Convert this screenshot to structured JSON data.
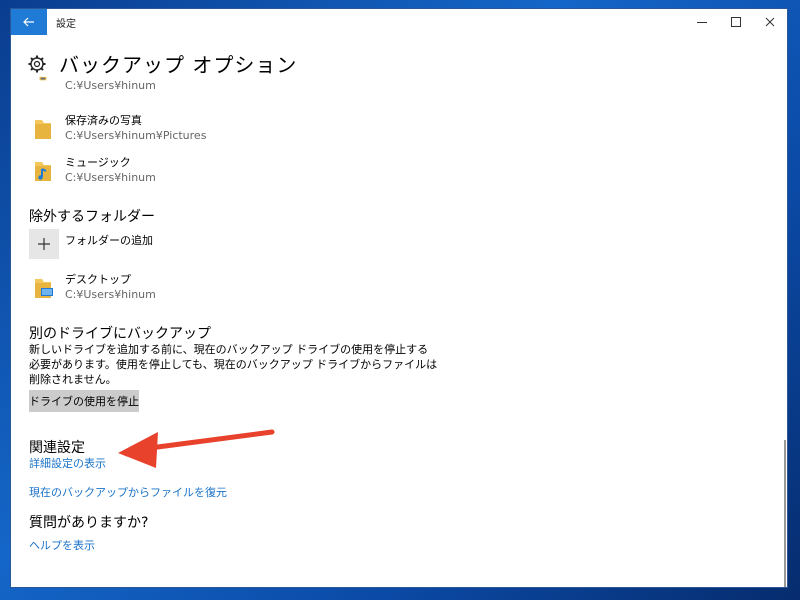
{
  "window": {
    "title": "設定",
    "back_icon": "arrow-left-icon",
    "accent_color": "#1f7bd6"
  },
  "page": {
    "title": "バックアップ オプション",
    "icon": "gear-icon"
  },
  "backup_folders": [
    {
      "name": "",
      "path": "C:¥Users¥hinum",
      "icon": "folder-icon"
    },
    {
      "name": "保存済みの写真",
      "path": "C:¥Users¥hinum¥Pictures",
      "icon": "folder-icon"
    },
    {
      "name": "ミュージック",
      "path": "C:¥Users¥hinum",
      "icon": "music-folder-icon"
    }
  ],
  "excluded": {
    "title": "除外するフォルダー",
    "add_label": "フォルダーの追加",
    "items": [
      {
        "name": "デスクトップ",
        "path": "C:¥Users¥hinum",
        "icon": "desktop-folder-icon"
      }
    ]
  },
  "other_drive": {
    "title": "別のドライブにバックアップ",
    "description_lines": [
      "新しいドライブを追加する前に、現在のバックアップ ドライブの使用を停止する",
      "必要があります。使用を停止しても、現在のバックアップ ドライブからファイルは",
      "削除されません。"
    ],
    "button_label": "ドライブの使用を停止"
  },
  "related": {
    "title": "関連設定",
    "link_advanced": "詳細設定の表示",
    "link_restore": "現在のバックアップからファイルを復元"
  },
  "help": {
    "title": "質問がありますか?",
    "link": "ヘルプを表示"
  },
  "colors": {
    "link": "#1a73c8",
    "annotation_arrow": "#e8412c"
  }
}
